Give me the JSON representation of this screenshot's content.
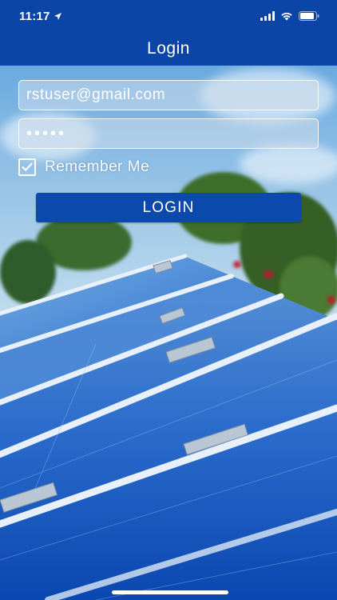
{
  "status_bar": {
    "time": "11:17",
    "icons": [
      "location-arrow-icon",
      "cellular-signal-icon",
      "wifi-icon",
      "battery-icon"
    ]
  },
  "nav": {
    "title": "Login"
  },
  "login_form": {
    "email_value": "rstuser@gmail.com",
    "password_value": "•••••",
    "remember_me_label": "Remember Me",
    "remember_me_checked": true,
    "login_button_label": "LOGIN"
  },
  "colors": {
    "brand_blue": "#0b45a8",
    "button_blue": "#0c49ac",
    "text_white": "#ffffff"
  }
}
